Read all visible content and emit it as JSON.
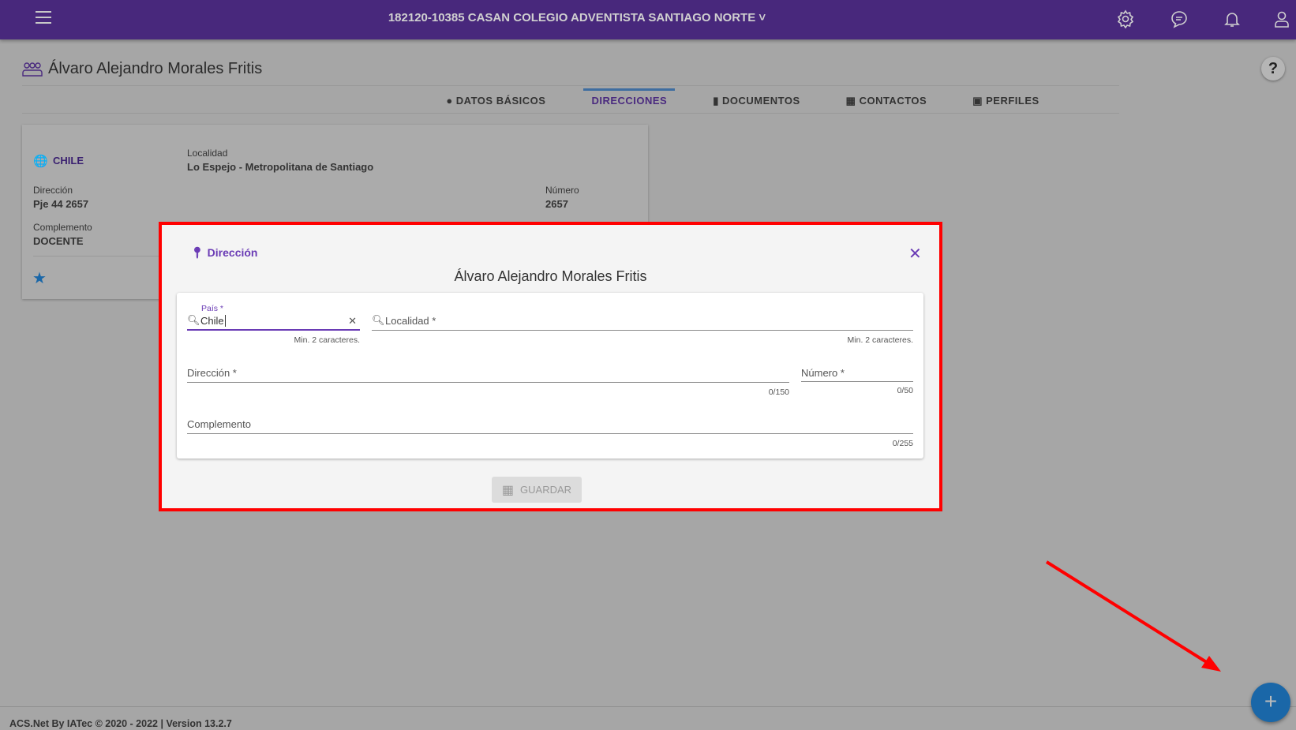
{
  "header": {
    "org": "182120-10385 CASAN COLEGIO ADVENTISTA SANTIAGO NORTE",
    "icons": [
      "menu-icon",
      "gear-icon",
      "chat-icon",
      "bell-icon",
      "user-icon"
    ],
    "color": "#48287c"
  },
  "page": {
    "title": "Álvaro Alejandro Morales Fritis",
    "help": "?"
  },
  "tabs": [
    {
      "label": "DATOS BÁSICOS"
    },
    {
      "label": "DIRECCIONES",
      "active": true
    },
    {
      "label": "DOCUMENTOS"
    },
    {
      "label": "CONTACTOS"
    },
    {
      "label": "PERFILES"
    }
  ],
  "card": {
    "country": "CHILE",
    "localidad_label": "Localidad",
    "localidad": "Lo Espejo - Metropolitana de Santiago",
    "direccion_label": "Dirección",
    "direccion": "Pje 44 2657",
    "numero_label": "Número",
    "numero": "2657",
    "complemento_label": "Complemento",
    "complemento": "DOCENTE"
  },
  "dialog": {
    "title": "Dirección",
    "name": "Álvaro Alejandro Morales Fritis",
    "pais_label": "País *",
    "pais_value": "Chile",
    "pais_hint": "Min. 2 caracteres.",
    "localidad_placeholder": "Localidad *",
    "localidad_hint": "Min. 2 caracteres.",
    "direccion_placeholder": "Dirección *",
    "direccion_count": "0/150",
    "numero_placeholder": "Número *",
    "numero_count": "0/50",
    "complemento_placeholder": "Complemento",
    "complemento_count": "0/255",
    "save": "GUARDAR"
  },
  "footer": "ACS.Net By IATec © 2020 - 2022 | Version 13.2.7",
  "fab": "+"
}
